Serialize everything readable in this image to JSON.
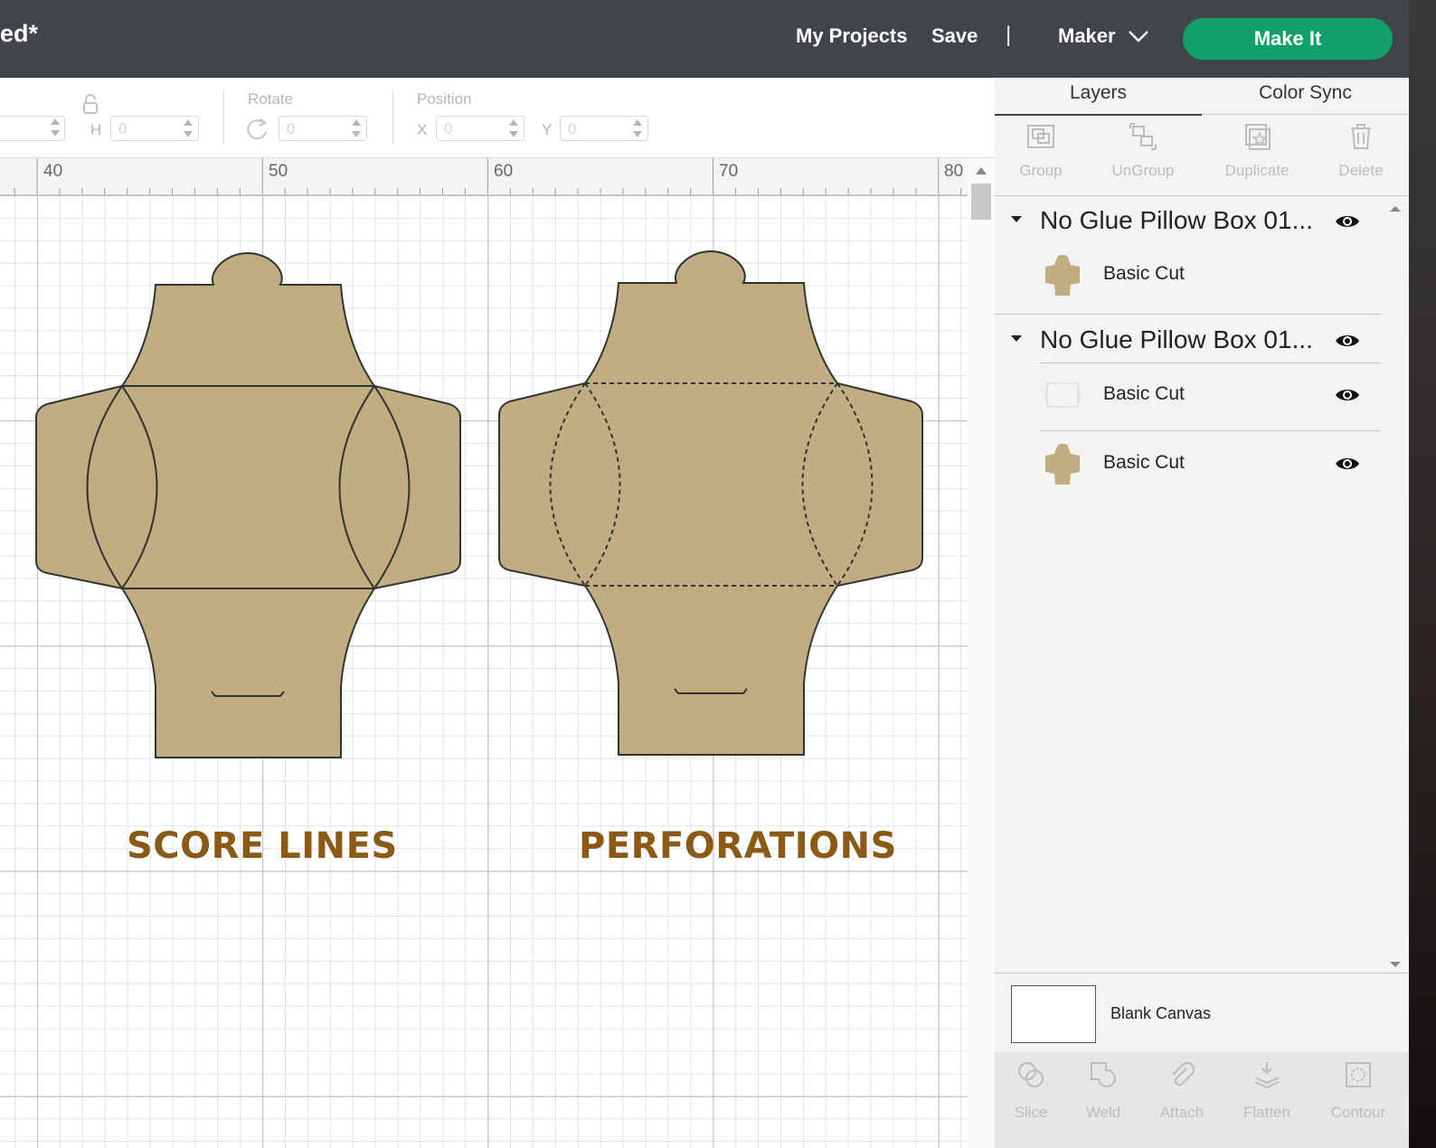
{
  "header": {
    "title": "ed*",
    "my_projects": "My Projects",
    "save": "Save",
    "separator": "|",
    "machine": "Maker",
    "make_it": "Make It",
    "accent_color": "#10a069",
    "bar_color": "#414549"
  },
  "edit_bar": {
    "h_label": "H",
    "h_value": "0",
    "w_value": "",
    "rotate_label": "Rotate",
    "rotate_value": "0",
    "position_label": "Position",
    "x_label": "X",
    "x_value": "0",
    "y_label": "Y",
    "y_value": "0"
  },
  "ruler": {
    "ticks": [
      "40",
      "50",
      "60",
      "70",
      "80"
    ]
  },
  "canvas": {
    "shape_color": "#c0ad81",
    "caption_color": "#8a5a16",
    "left_caption": "SCORE LINES",
    "right_caption": "PERFORATIONS"
  },
  "panel": {
    "tabs": [
      "Layers",
      "Color Sync"
    ],
    "tools": [
      "Group",
      "UnGroup",
      "Duplicate",
      "Delete"
    ],
    "groups": [
      {
        "name": "No Glue Pillow Box 01...",
        "layers": [
          {
            "name": "Basic Cut"
          }
        ]
      },
      {
        "name": "No Glue Pillow Box 01...",
        "layers": [
          {
            "name": "Basic Cut"
          },
          {
            "name": "Basic Cut"
          }
        ]
      }
    ],
    "blank_canvas": "Blank Canvas",
    "bottom_tools": [
      "Slice",
      "Weld",
      "Attach",
      "Flatten",
      "Contour"
    ]
  }
}
